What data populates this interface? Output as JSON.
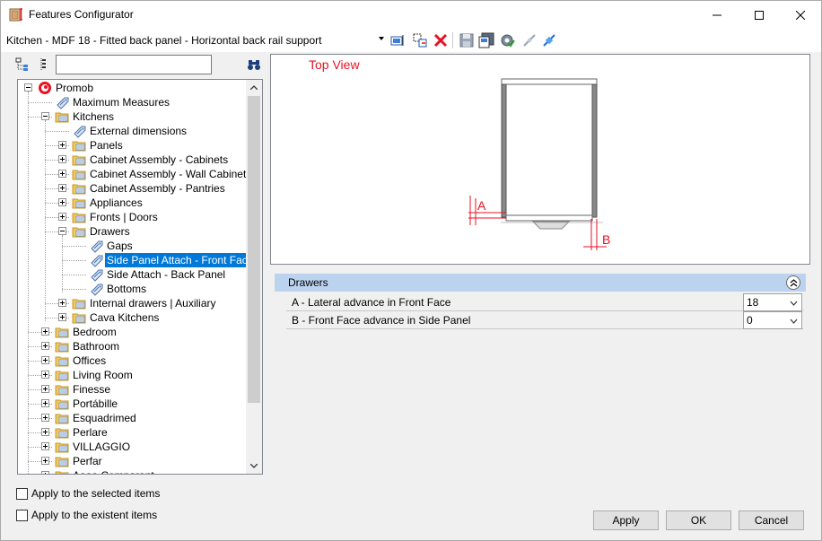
{
  "window": {
    "title": "Features Configurator",
    "controls": {
      "minimize_icon": "minimize-icon",
      "maximize_icon": "maximize-icon",
      "close_icon": "close-icon"
    }
  },
  "toolbar": {
    "feature_path": "Kitchen - MDF 18 - Fitted back panel - Horizontal back rail support",
    "icons": [
      "select-item-icon",
      "copy-item-icon",
      "delete-icon",
      "save-icon",
      "save-as-icon",
      "settings-icon",
      "disconnect-icon",
      "connect-icon"
    ],
    "delete_color": "#e81123"
  },
  "tree_toolbar": {
    "icons": [
      "collapse-tree-icon",
      "expand-tree-icon",
      "binoculars-icon"
    ],
    "search_value": "",
    "search_placeholder": ""
  },
  "tree": {
    "items": [
      {
        "label": "Promob",
        "level": 0,
        "expander": "minus",
        "icon": "promob-logo-icon"
      },
      {
        "label": "Maximum Measures",
        "level": 1,
        "expander": "none",
        "icon": "tag-icon"
      },
      {
        "label": "Kitchens",
        "level": 1,
        "expander": "minus",
        "icon": "folder-icon"
      },
      {
        "label": "External dimensions",
        "level": 2,
        "expander": "none",
        "icon": "tag-icon"
      },
      {
        "label": "Panels",
        "level": 2,
        "expander": "plus",
        "icon": "folder-icon"
      },
      {
        "label": "Cabinet Assembly - Cabinets",
        "level": 2,
        "expander": "plus",
        "icon": "folder-icon"
      },
      {
        "label": "Cabinet Assembly - Wall Cabinets",
        "level": 2,
        "expander": "plus",
        "icon": "folder-icon"
      },
      {
        "label": "Cabinet Assembly - Pantries",
        "level": 2,
        "expander": "plus",
        "icon": "folder-icon"
      },
      {
        "label": "Appliances",
        "level": 2,
        "expander": "plus",
        "icon": "folder-icon"
      },
      {
        "label": "Fronts | Doors",
        "level": 2,
        "expander": "plus",
        "icon": "folder-icon"
      },
      {
        "label": "Drawers",
        "level": 2,
        "expander": "minus",
        "icon": "folder-icon"
      },
      {
        "label": "Gaps",
        "level": 3,
        "expander": "none",
        "icon": "tag-icon"
      },
      {
        "label": "Side Panel Attach - Front Face",
        "level": 3,
        "expander": "none",
        "icon": "tag-icon",
        "selected": true
      },
      {
        "label": "Side Attach - Back Panel",
        "level": 3,
        "expander": "none",
        "icon": "tag-icon"
      },
      {
        "label": "Bottoms",
        "level": 3,
        "expander": "none",
        "icon": "tag-icon"
      },
      {
        "label": "Internal drawers | Auxiliary",
        "level": 2,
        "expander": "plus",
        "icon": "folder-icon"
      },
      {
        "label": "Cava Kitchens",
        "level": 2,
        "expander": "plus",
        "icon": "folder-icon"
      },
      {
        "label": "Bedroom",
        "level": 1,
        "expander": "plus",
        "icon": "folder-icon"
      },
      {
        "label": "Bathroom",
        "level": 1,
        "expander": "plus",
        "icon": "folder-icon"
      },
      {
        "label": "Offices",
        "level": 1,
        "expander": "plus",
        "icon": "folder-icon"
      },
      {
        "label": "Living Room",
        "level": 1,
        "expander": "plus",
        "icon": "folder-icon"
      },
      {
        "label": "Finesse",
        "level": 1,
        "expander": "plus",
        "icon": "folder-icon"
      },
      {
        "label": "Portábille",
        "level": 1,
        "expander": "plus",
        "icon": "folder-icon"
      },
      {
        "label": "Esquadrimed",
        "level": 1,
        "expander": "plus",
        "icon": "folder-icon"
      },
      {
        "label": "Perlare",
        "level": 1,
        "expander": "plus",
        "icon": "folder-icon"
      },
      {
        "label": "VILLAGGIO",
        "level": 1,
        "expander": "plus",
        "icon": "folder-icon"
      },
      {
        "label": "Perfar",
        "level": 1,
        "expander": "plus",
        "icon": "folder-icon"
      },
      {
        "label": "Aaaa Comparant",
        "level": 1,
        "expander": "plus",
        "icon": "folder-icon"
      }
    ],
    "selection_color": "#0078d7"
  },
  "preview": {
    "title": "Top View",
    "title_color": "#e81123",
    "dimension_labels": {
      "a": "A",
      "b": "B"
    }
  },
  "properties": {
    "group": "Drawers",
    "group_color": "#bcd3ef",
    "collapse_icon": "double-chevron-up-icon",
    "rows": [
      {
        "label": "A - Lateral advance in Front Face",
        "value": "18"
      },
      {
        "label": "B - Front Face advance in Side Panel",
        "value": "0"
      }
    ]
  },
  "options": {
    "apply_selected": "Apply to the selected items",
    "apply_existent": "Apply to the existent items"
  },
  "buttons": {
    "apply": "Apply",
    "ok": "OK",
    "cancel": "Cancel"
  }
}
